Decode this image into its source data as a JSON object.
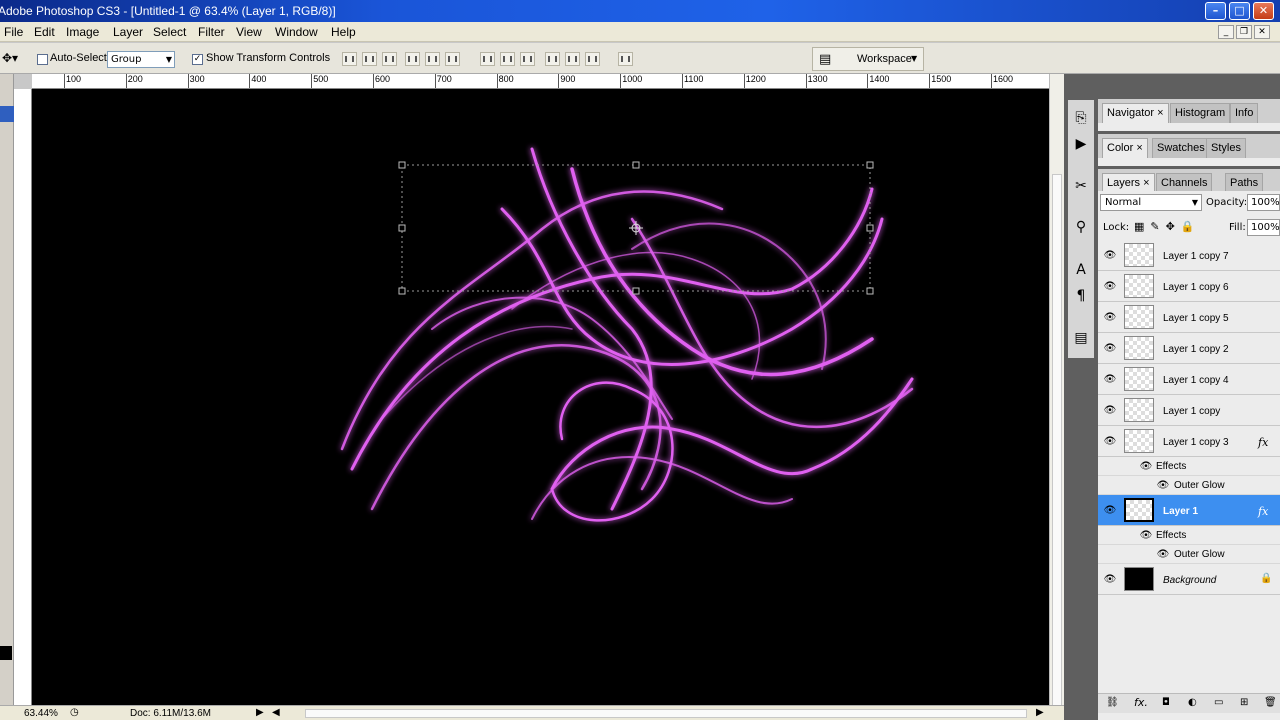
{
  "window": {
    "title": "Adobe Photoshop CS3 - [Untitled-1 @ 63.4% (Layer 1, RGB/8)]"
  },
  "menu": [
    "File",
    "Edit",
    "Image",
    "Layer",
    "Select",
    "Filter",
    "View",
    "Window",
    "Help"
  ],
  "options": {
    "auto_select_label": "Auto-Select:",
    "auto_select_value": "Group",
    "show_transform_label": "Show Transform Controls",
    "show_transform_checked": true,
    "workspace_label": "Workspace"
  },
  "ruler": {
    "labels": [
      "100",
      "200",
      "300",
      "400",
      "500",
      "600",
      "700",
      "800",
      "900",
      "1000",
      "1100",
      "1200",
      "1300",
      "1400",
      "1500",
      "1600"
    ]
  },
  "status": {
    "zoom": "63.44%",
    "doc": "Doc: 6.11M/13.6M"
  },
  "panels": {
    "group1_tabs": [
      "Navigator",
      "Histogram",
      "Info"
    ],
    "group2_tabs": [
      "Color",
      "Swatches",
      "Styles"
    ],
    "layers_tabs": [
      "Layers",
      "Channels",
      "Paths"
    ],
    "blend_mode": "Normal",
    "opacity_label": "Opacity:",
    "opacity_value": "100%",
    "lock_label": "Lock:",
    "fill_label": "Fill:",
    "fill_value": "100%"
  },
  "layers": [
    {
      "name": "Layer 1 copy 7"
    },
    {
      "name": "Layer 1 copy 6"
    },
    {
      "name": "Layer 1 copy 5"
    },
    {
      "name": "Layer 1 copy 2"
    },
    {
      "name": "Layer 1 copy 4"
    },
    {
      "name": "Layer 1 copy"
    },
    {
      "name": "Layer 1 copy 3",
      "fx": "fx"
    },
    {
      "name": "Layer 1",
      "fx": "fx",
      "selected": true
    },
    {
      "name": "Background",
      "locked": true
    }
  ],
  "effects_label": "Effects",
  "outer_glow_label": "Outer Glow",
  "colors": {
    "accent_selection": "#3d8ff0",
    "glow": "#e060f0",
    "title_bar": "#1f62e8"
  }
}
